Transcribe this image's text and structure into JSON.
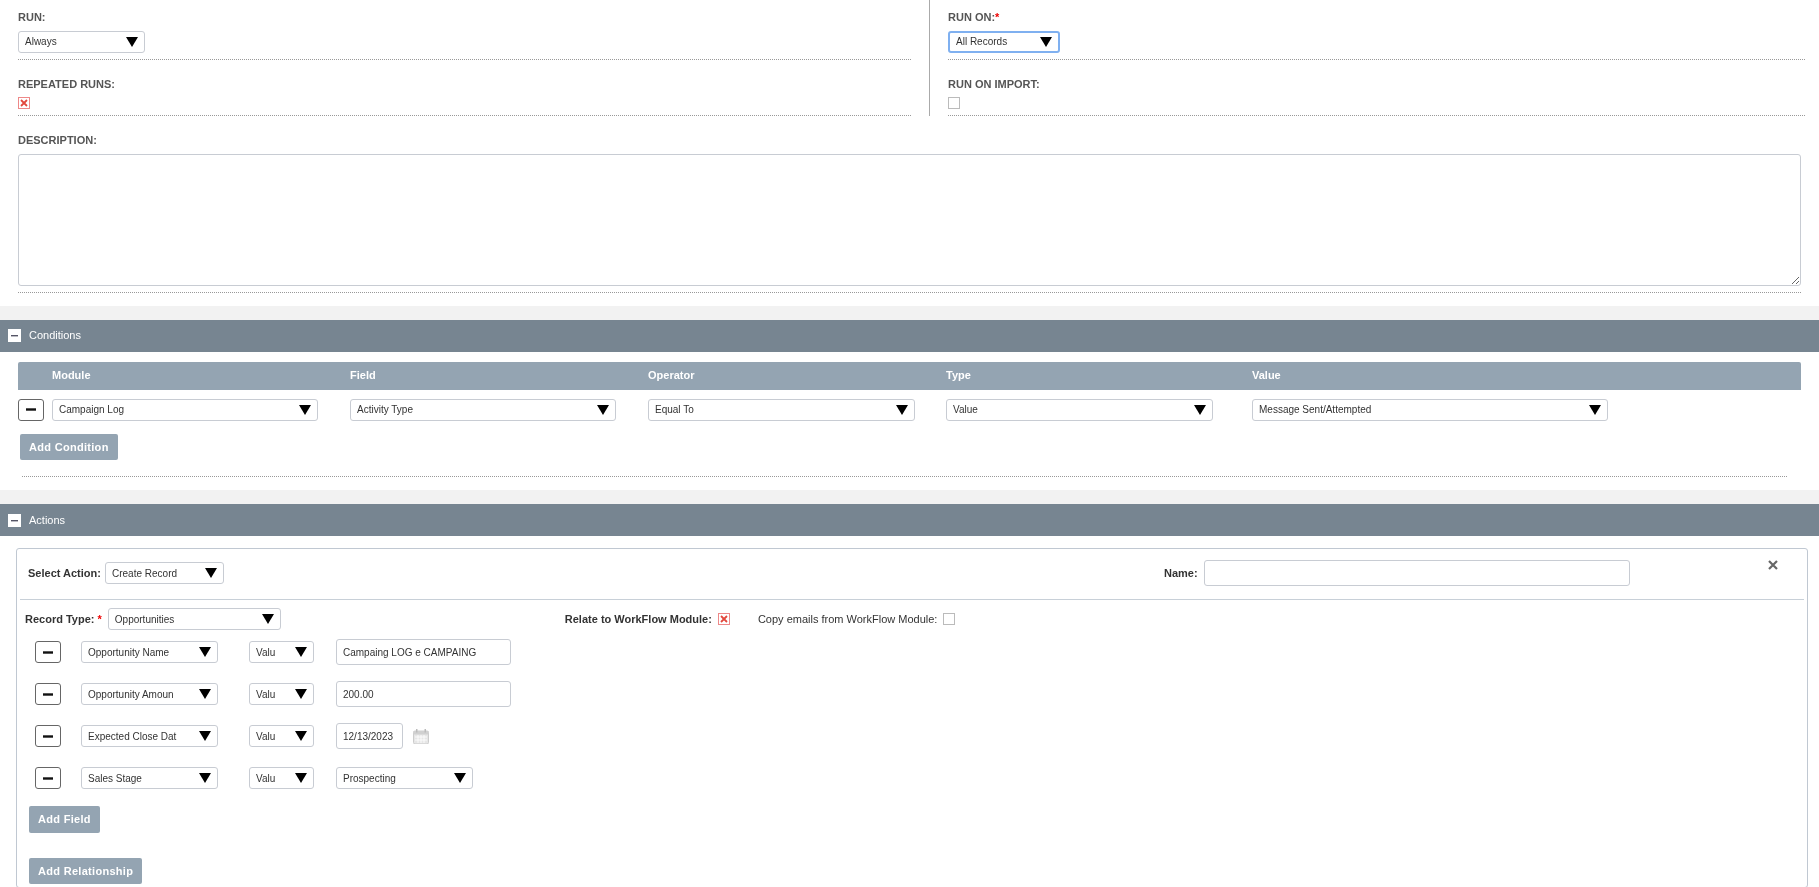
{
  "settings": {
    "run": {
      "label": "RUN:",
      "value": "Always"
    },
    "run_on": {
      "label": "RUN ON:",
      "required_mark": "*",
      "value": "All Records",
      "focused": true
    },
    "repeated_runs": {
      "label": "REPEATED RUNS:",
      "checked": true
    },
    "run_on_import": {
      "label": "RUN ON IMPORT:",
      "checked": false
    },
    "description": {
      "label": "DESCRIPTION:"
    }
  },
  "conditions": {
    "title": "Conditions",
    "expanded": true,
    "columns": [
      "Module",
      "Field",
      "Operator",
      "Type",
      "Value"
    ],
    "rows": [
      {
        "module": "Campaign Log",
        "field": "Activity Type",
        "operator": "Equal To",
        "type": "Value",
        "value": "Message Sent/Attempted"
      }
    ],
    "add_button": "Add Condition"
  },
  "actions": {
    "title": "Actions",
    "expanded": true,
    "select_label": "Select Action:",
    "select_value": "Create Record",
    "name_label": "Name:",
    "record_type_label": "Record Type:",
    "required_mark": "*",
    "record_type": "Opportunities",
    "relate_label": "Relate to WorkFlow Module:",
    "relate_checked": true,
    "copy_label": "Copy emails from WorkFlow Module:",
    "copy_checked": false,
    "fields": [
      {
        "kind": "text",
        "field": "Opportunity Name",
        "type": "Valu",
        "value": "Campaing LOG e CAMPAING"
      },
      {
        "kind": "text",
        "field": "Opportunity Amoun",
        "type": "Valu",
        "value": "200.00"
      },
      {
        "kind": "date",
        "field": "Expected Close Dat",
        "type": "Valu",
        "value": "12/13/2023"
      },
      {
        "kind": "select",
        "field": "Sales Stage",
        "type": "Valu",
        "value": "Prospecting"
      }
    ],
    "add_field": "Add Field",
    "add_relationship": "Add Relationship"
  }
}
